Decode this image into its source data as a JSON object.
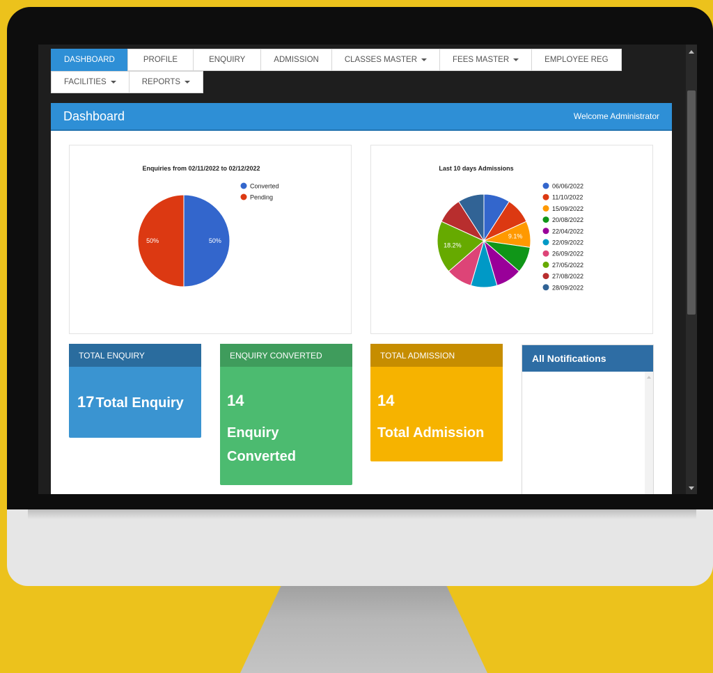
{
  "nav": {
    "row1": [
      {
        "label": "DASHBOARD",
        "active": true
      },
      {
        "label": "PROFILE"
      },
      {
        "label": "ENQUIRY"
      },
      {
        "label": "ADMISSION"
      },
      {
        "label": "CLASSES MASTER",
        "dropdown": true
      },
      {
        "label": "FEES MASTER",
        "dropdown": true
      },
      {
        "label": "EMPLOYEE REG"
      }
    ],
    "row2": [
      {
        "label": "FACILITIES",
        "dropdown": true
      },
      {
        "label": "REPORTS",
        "dropdown": true
      }
    ]
  },
  "header": {
    "title": "Dashboard",
    "welcome": "Welcome Administrator"
  },
  "colors": {
    "primary": "#2e8fd6",
    "green": "#4cbb70",
    "amber": "#f6b300",
    "notif": "#2e6da4"
  },
  "chart_data": [
    {
      "type": "pie",
      "title": "Enquiries from 02/11/2022 to 02/12/2022",
      "legend_position": "right",
      "slices": [
        {
          "label": "Converted",
          "value": 50,
          "color": "#3366cc",
          "data_label": "50%"
        },
        {
          "label": "Pending",
          "value": 50,
          "color": "#dc3912",
          "data_label": "50%"
        }
      ]
    },
    {
      "type": "pie",
      "title": "Last 10 days Admissions",
      "legend_position": "right",
      "slices": [
        {
          "label": "06/06/2022",
          "value": 9.1,
          "color": "#3366cc"
        },
        {
          "label": "11/10/2022",
          "value": 9.1,
          "color": "#dc3912"
        },
        {
          "label": "15/09/2022",
          "value": 9.1,
          "color": "#ff9900",
          "data_label": "9.1%"
        },
        {
          "label": "20/08/2022",
          "value": 9.1,
          "color": "#109618"
        },
        {
          "label": "22/04/2022",
          "value": 9.1,
          "color": "#990099"
        },
        {
          "label": "22/09/2022",
          "value": 9.1,
          "color": "#0099c6"
        },
        {
          "label": "26/09/2022",
          "value": 9.1,
          "color": "#dd4477"
        },
        {
          "label": "27/05/2022",
          "value": 18.2,
          "color": "#66aa00",
          "data_label": "18.2%"
        },
        {
          "label": "27/08/2022",
          "value": 9.1,
          "color": "#b82e2e"
        },
        {
          "label": "28/09/2022",
          "value": 9.1,
          "color": "#316395"
        }
      ]
    }
  ],
  "stats": [
    {
      "header": "TOTAL ENQUIRY",
      "value": "17",
      "label": "Total Enquiry"
    },
    {
      "header": "ENQUIRY CONVERTED",
      "value": "14",
      "label_line1": "Enquiry",
      "label_line2": "Converted"
    },
    {
      "header": "TOTAL ADMISSION",
      "value": "14",
      "label": "Total Admission"
    }
  ],
  "notifications": {
    "title": "All Notifications"
  }
}
